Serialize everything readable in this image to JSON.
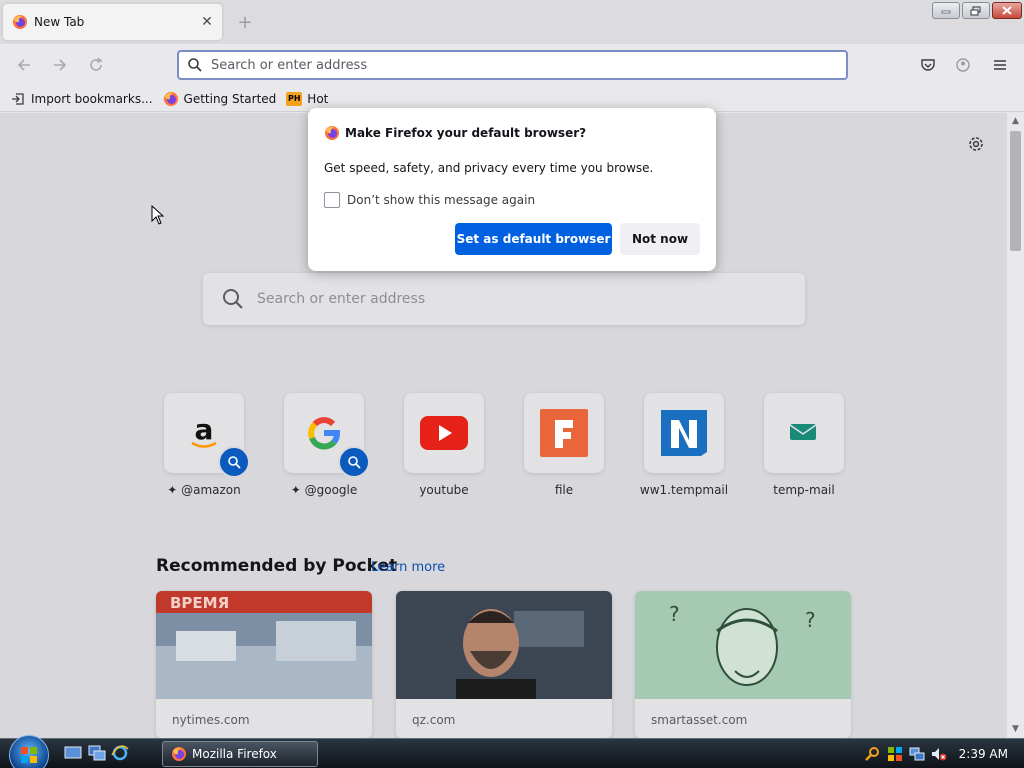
{
  "tab": {
    "title": "New Tab",
    "close_glyph": "✕",
    "new_tab_glyph": "+"
  },
  "urlbar": {
    "placeholder": "Search or enter address"
  },
  "bookmarks": [
    {
      "label": "Import bookmarks...",
      "icon": "import-icon"
    },
    {
      "label": "Getting Started",
      "icon": "firefox-icon"
    },
    {
      "label": "Hot",
      "icon": "ph-icon",
      "badge": "PH"
    }
  ],
  "dialog": {
    "title": "Make Firefox your default browser?",
    "body": "Get speed, safety, and privacy every time you browse.",
    "checkbox_label": "Don’t show this message again",
    "primary_button": "Set as default browser",
    "secondary_button": "Not now"
  },
  "newtab": {
    "search_placeholder": "Search or enter address",
    "top_sites": [
      {
        "label": "@amazon",
        "pinned": true,
        "search": true
      },
      {
        "label": "@google",
        "pinned": true,
        "search": true
      },
      {
        "label": "youtube"
      },
      {
        "label": "file"
      },
      {
        "label": "ww1.tempmail"
      },
      {
        "label": "temp-mail"
      }
    ],
    "pocket_heading": "Recommended by Pocket",
    "pocket_learn_more": "Learn more",
    "cards": [
      {
        "source": "nytimes.com",
        "thumb_text": "ВРЕМЯ"
      },
      {
        "source": "qz.com"
      },
      {
        "source": "smartasset.com"
      }
    ]
  },
  "taskbar": {
    "task_label": "Mozilla Firefox",
    "clock": "2:39 AM"
  },
  "colors": {
    "primary_button": "#0061e0",
    "link": "#0a4eaf",
    "search_badge": "#0b5bbf",
    "youtube_red": "#e62117",
    "file_orange": "#e8663a",
    "tempmail_blue": "#1a6fc0"
  }
}
